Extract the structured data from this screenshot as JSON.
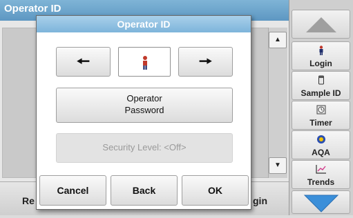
{
  "background": {
    "title": "Operator ID",
    "bottom_left": "Re",
    "bottom_right": "gin"
  },
  "side_panel": {
    "buttons": [
      {
        "label": "Login",
        "icon": "person-icon"
      },
      {
        "label": "Sample ID",
        "icon": "flask-icon"
      },
      {
        "label": "Timer",
        "icon": "timer-icon"
      },
      {
        "label": "AQA",
        "icon": "aqa-icon"
      },
      {
        "label": "Trends",
        "icon": "trends-icon"
      }
    ]
  },
  "dialog": {
    "title": "Operator ID",
    "operator_password_line1": "Operator",
    "operator_password_line2": "Password",
    "security_level": "Security Level:  <Off>",
    "cancel": "Cancel",
    "back": "Back",
    "ok": "OK"
  },
  "colors": {
    "title_bar": "#7fb4d6",
    "dialog_title": "#8cc0e2",
    "person_icon": "#c0392b",
    "aqa_icon": "#2a4fb0",
    "arrow_blue": "#3b8fd9"
  }
}
